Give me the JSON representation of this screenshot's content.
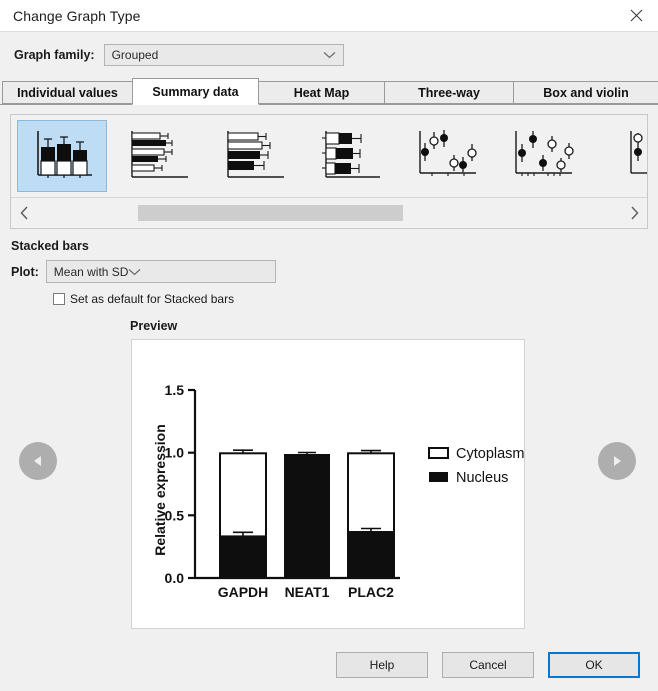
{
  "window": {
    "title": "Change Graph Type",
    "close_icon": "close-icon"
  },
  "graph_family": {
    "label": "Graph family:",
    "value": "Grouped",
    "chevron_icon": "chevron-down-icon"
  },
  "tabs": [
    {
      "label": "Individual values",
      "active": false
    },
    {
      "label": "Summary data",
      "active": true
    },
    {
      "label": "Heat Map",
      "active": false
    },
    {
      "label": "Three-way",
      "active": false
    },
    {
      "label": "Box and violin",
      "active": false
    }
  ],
  "gallery": {
    "selected_index": 0,
    "prev_icon": "chevron-left-icon",
    "next_icon": "chevron-right-icon",
    "thumbnails": [
      {
        "name": "stacked-bars-vertical",
        "selected": true
      },
      {
        "name": "grouped-bars-horizontal",
        "selected": false
      },
      {
        "name": "interleaved-bars-horizontal",
        "selected": false
      },
      {
        "name": "stacked-bars-horizontal",
        "selected": false
      },
      {
        "name": "scatter-with-error-bars",
        "selected": false
      },
      {
        "name": "scatter-with-error-bars-alt",
        "selected": false
      },
      {
        "name": "scatter-partial",
        "selected": false
      }
    ]
  },
  "settings": {
    "section_title": "Stacked bars",
    "plot_label": "Plot:",
    "plot_value": "Mean with SD",
    "set_default_label": "Set as default for Stacked bars",
    "set_default_checked": false
  },
  "preview": {
    "title": "Preview",
    "prev_icon": "prev-arrow-icon",
    "next_icon": "next-arrow-icon"
  },
  "footer": {
    "help_label": "Help",
    "cancel_label": "Cancel",
    "ok_label": "OK"
  },
  "colors": {
    "accent": "#0078d7",
    "selection": "#bfdcf5",
    "dialog_bg": "#f0f0f0",
    "series_cytoplasm": "#ffffff",
    "series_nucleus": "#000000"
  },
  "chart_data": {
    "type": "bar",
    "title": "",
    "xlabel": "",
    "ylabel": "Relative expression",
    "ylim": [
      0.0,
      1.5
    ],
    "yticks": [
      "0.0",
      "0.5",
      "1.0",
      "1.5"
    ],
    "ytick_values": [
      0.0,
      0.5,
      1.0,
      1.5
    ],
    "grid": false,
    "stacked": true,
    "legend_position": "right",
    "categories": [
      "GAPDH",
      "NEAT1",
      "PLAC2"
    ],
    "series": [
      {
        "name": "Nucleus",
        "values": [
          0.34,
          0.99,
          0.375
        ],
        "errors": [
          0.025,
          0.005,
          0.02
        ],
        "color": "#000000"
      },
      {
        "name": "Cytoplasm",
        "values": [
          0.655,
          0.0,
          0.62
        ],
        "errors": [
          0.025,
          0.0,
          0.015
        ],
        "color": "#ffffff"
      }
    ],
    "totals": [
      0.995,
      0.99,
      0.995
    ]
  }
}
